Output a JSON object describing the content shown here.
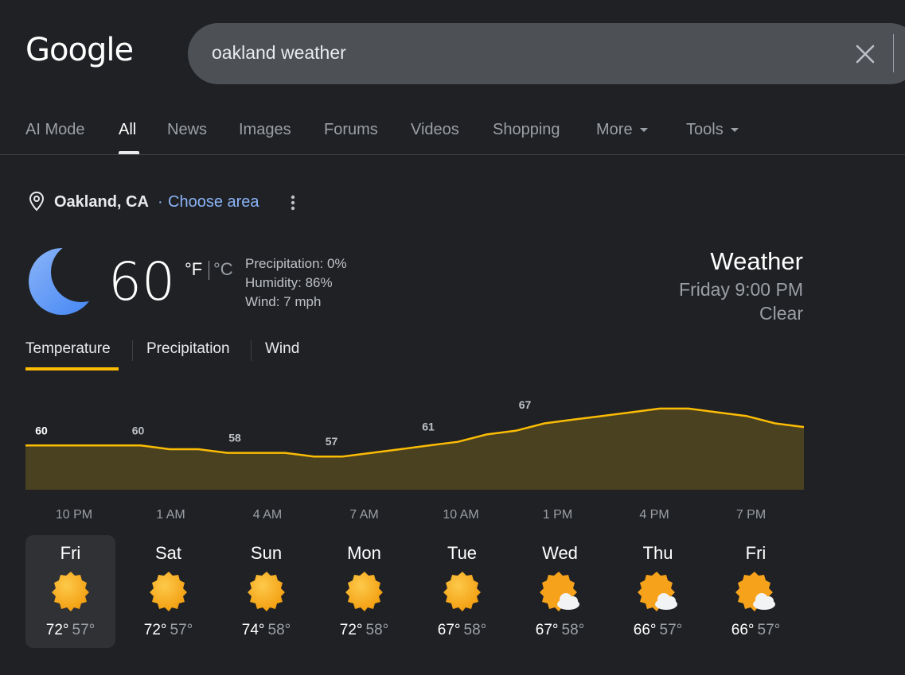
{
  "logo": "Google",
  "search": {
    "query": "oakland weather"
  },
  "tabs": [
    {
      "label": "AI Mode",
      "active": false
    },
    {
      "label": "All",
      "active": true
    },
    {
      "label": "News",
      "active": false
    },
    {
      "label": "Images",
      "active": false
    },
    {
      "label": "Forums",
      "active": false
    },
    {
      "label": "Videos",
      "active": false
    },
    {
      "label": "Shopping",
      "active": false
    },
    {
      "label": "More",
      "active": false,
      "dropdown": true
    },
    {
      "label": "Tools",
      "active": false,
      "dropdown": true
    }
  ],
  "location": {
    "name": "Oakland, CA",
    "separator": "·",
    "choose_area": "Choose area"
  },
  "current": {
    "icon": "moon-icon",
    "temperature": "60",
    "unit_f": "°F",
    "unit_c": "°C",
    "precipitation": "Precipitation: 0%",
    "humidity": "Humidity: 86%",
    "wind": "Wind: 7 mph",
    "title": "Weather",
    "time": "Friday 9:00 PM",
    "condition": "Clear"
  },
  "chart_tabs": [
    "Temperature",
    "Precipitation",
    "Wind"
  ],
  "chart_data": {
    "type": "area",
    "title": "",
    "xlabel": "",
    "ylabel": "",
    "ylim": [
      48,
      73
    ],
    "grid": false,
    "x_labels": [
      "10 PM",
      "1 AM",
      "4 AM",
      "7 AM",
      "10 AM",
      "1 PM",
      "4 PM",
      "7 PM"
    ],
    "series": [
      {
        "values": [
          60,
          60,
          60,
          60,
          60,
          59,
          59,
          58,
          58,
          58,
          57,
          57,
          58,
          59,
          60,
          61,
          63,
          64,
          66,
          67,
          68,
          69,
          70,
          70,
          69,
          68,
          66,
          65
        ]
      }
    ],
    "labels": [
      {
        "index": 0,
        "value": "60"
      },
      {
        "index": 3,
        "value": "60"
      },
      {
        "index": 6,
        "value": "58"
      },
      {
        "index": 9,
        "value": "57"
      },
      {
        "index": 12,
        "value": "61"
      },
      {
        "index": 15,
        "value": "67"
      },
      {
        "index": 18,
        "value": "71"
      },
      {
        "index": 21,
        "value": "70"
      }
    ],
    "line_color": "#fbbc04",
    "fill_color": "#4a4121"
  },
  "forecast": [
    {
      "day": "Fri",
      "icon": "sun-icon",
      "high": "72°",
      "low": "57°",
      "selected": true
    },
    {
      "day": "Sat",
      "icon": "sun-icon",
      "high": "72°",
      "low": "57°",
      "selected": false
    },
    {
      "day": "Sun",
      "icon": "sun-icon",
      "high": "74°",
      "low": "58°",
      "selected": false
    },
    {
      "day": "Mon",
      "icon": "sun-icon",
      "high": "72°",
      "low": "58°",
      "selected": false
    },
    {
      "day": "Tue",
      "icon": "sun-icon",
      "high": "67°",
      "low": "58°",
      "selected": false
    },
    {
      "day": "Wed",
      "icon": "partly-cloudy-icon",
      "high": "67°",
      "low": "58°",
      "selected": false
    },
    {
      "day": "Thu",
      "icon": "partly-cloudy-icon",
      "high": "66°",
      "low": "57°",
      "selected": false
    },
    {
      "day": "Fri",
      "icon": "partly-cloudy-icon",
      "high": "66°",
      "low": "57°",
      "selected": false
    }
  ],
  "colors": {
    "background": "#202124",
    "link": "#8ab4f8",
    "accent": "#fbbc04",
    "moon": "#669df6",
    "sun": "#fbab18"
  }
}
